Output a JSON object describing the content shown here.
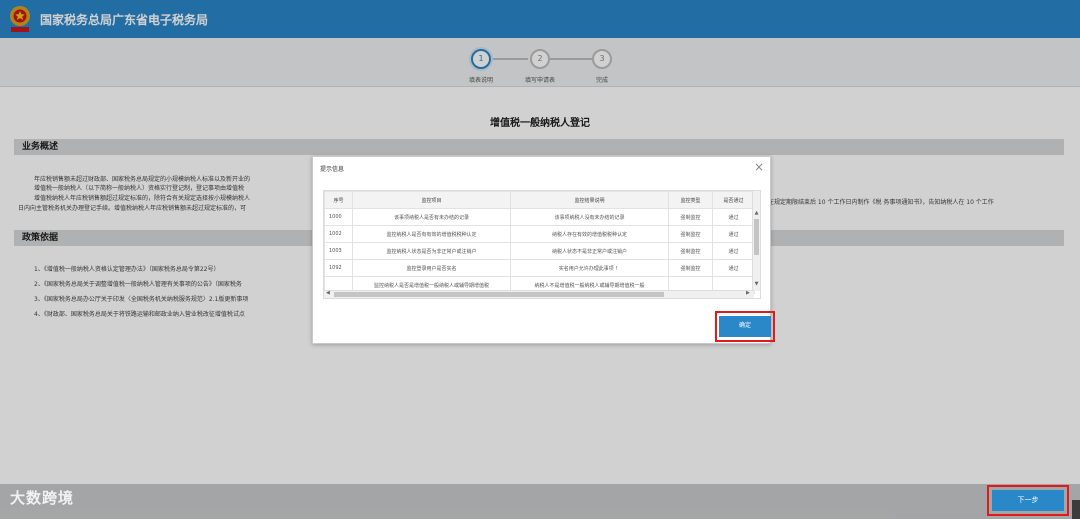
{
  "header": {
    "title": "国家税务总局广东省电子税务局"
  },
  "steps": [
    {
      "num": "1",
      "label": "填表说明"
    },
    {
      "num": "2",
      "label": "填写申请表"
    },
    {
      "num": "3",
      "label": "完成"
    }
  ],
  "page": {
    "title": "增值税一般纳税人登记"
  },
  "sections": {
    "overview": {
      "title": "业务概述",
      "lines": [
        "年应税销售额未超过财政部、国家税务总局规定的小规模纳税人标准以及新开业的",
        "增值税一般纳税人（以下简称一般纳税人）资格实行登记制，登记事项由增值税",
        "增值税纳税人年应税销售额超过规定标准的，除符合有关规定选择按小规模纳税人",
        "日内向主管税务机关办理登记手续。增值税纳税人年应税销售额未超过规定标准的，可"
      ],
      "right_line": "，在规定期限结束后 10 个工作日内制作《税 务事项通知书》，告知纳税人在 10 个工作"
    },
    "policy": {
      "title": "政策依据",
      "items": [
        "1、《增值税一般纳税人资格认定管理办法》（国家税务总局令第22号）",
        "2、《国家税务总局关于调整增值税一般纳税人管理有关事项的公告》（国家税务",
        "3、《国家税务总局办公厅关于印发〈全国税务机关纳税服务规范〉2.1版更新事项",
        "4、《财政部、国家税务总局关于将铁路运输和邮政业纳入营业税改征增值税试点"
      ]
    }
  },
  "modal": {
    "title": "提示信息",
    "close": "×",
    "columns": [
      "序号",
      "监控项目",
      "监控结果说明",
      "监控类型",
      "是否通过"
    ],
    "rows": [
      [
        "1000",
        "该事项纳税人是否有未办结的记录",
        "该事项纳税人没有未办结的记录",
        "强制监控",
        "通过"
      ],
      [
        "1002",
        "监控纳税人是否有有效的增值税税种认定",
        "纳税人存在有效的增值税税种认定",
        "强制监控",
        "通过"
      ],
      [
        "1003",
        "监控纳税人状态是否为非正常户或注销户",
        "纳税人状态不是非正常户或注销户",
        "强制监控",
        "通过"
      ],
      [
        "1092",
        "监控登录用户是否实名",
        "实名用户允许办理此事项 ！",
        "强制监控",
        "通过"
      ],
      [
        "",
        "监控纳税人是否是增值税一般纳税人或辅导期增值税",
        "纳税人不是增值税一般纳税人或辅导期增值税一般",
        "",
        ""
      ]
    ],
    "ok_label": "确定"
  },
  "footer": {
    "watermark": "大数跨境",
    "next_label": "下一步"
  },
  "colors": {
    "brand": "#2a87c8",
    "highlight": "#e01b1b"
  }
}
